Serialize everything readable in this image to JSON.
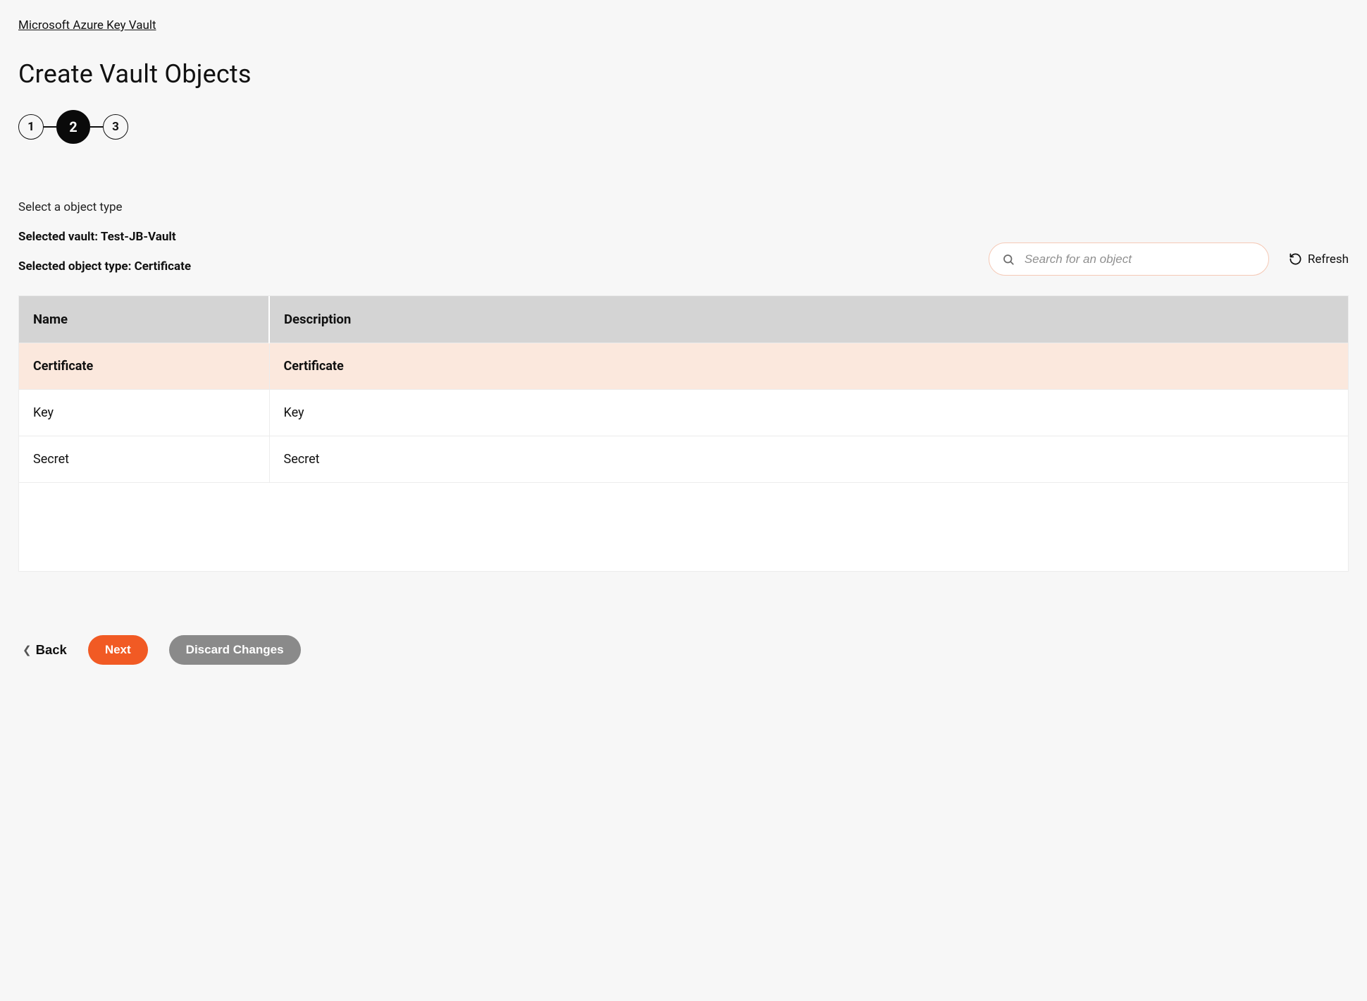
{
  "breadcrumb": "Microsoft Azure Key Vault",
  "page_title": "Create Vault Objects",
  "stepper": {
    "steps": [
      "1",
      "2",
      "3"
    ],
    "active_index": 1
  },
  "section_label": "Select a object type",
  "selected_vault_line": "Selected vault: Test-JB-Vault",
  "selected_type_line": "Selected object type: Certificate",
  "search": {
    "placeholder": "Search for an object",
    "value": ""
  },
  "refresh_label": "Refresh",
  "table": {
    "columns": [
      "Name",
      "Description"
    ],
    "rows": [
      {
        "name": "Certificate",
        "description": "Certificate",
        "selected": true
      },
      {
        "name": "Key",
        "description": "Key",
        "selected": false
      },
      {
        "name": "Secret",
        "description": "Secret",
        "selected": false
      }
    ]
  },
  "footer": {
    "back": "Back",
    "next": "Next",
    "discard": "Discard Changes"
  },
  "colors": {
    "primary": "#f15a24",
    "muted": "#8a8a8a",
    "row_selected": "#fbe8dd",
    "header_bg": "#d4d4d4",
    "search_border": "#f5c9b6"
  }
}
